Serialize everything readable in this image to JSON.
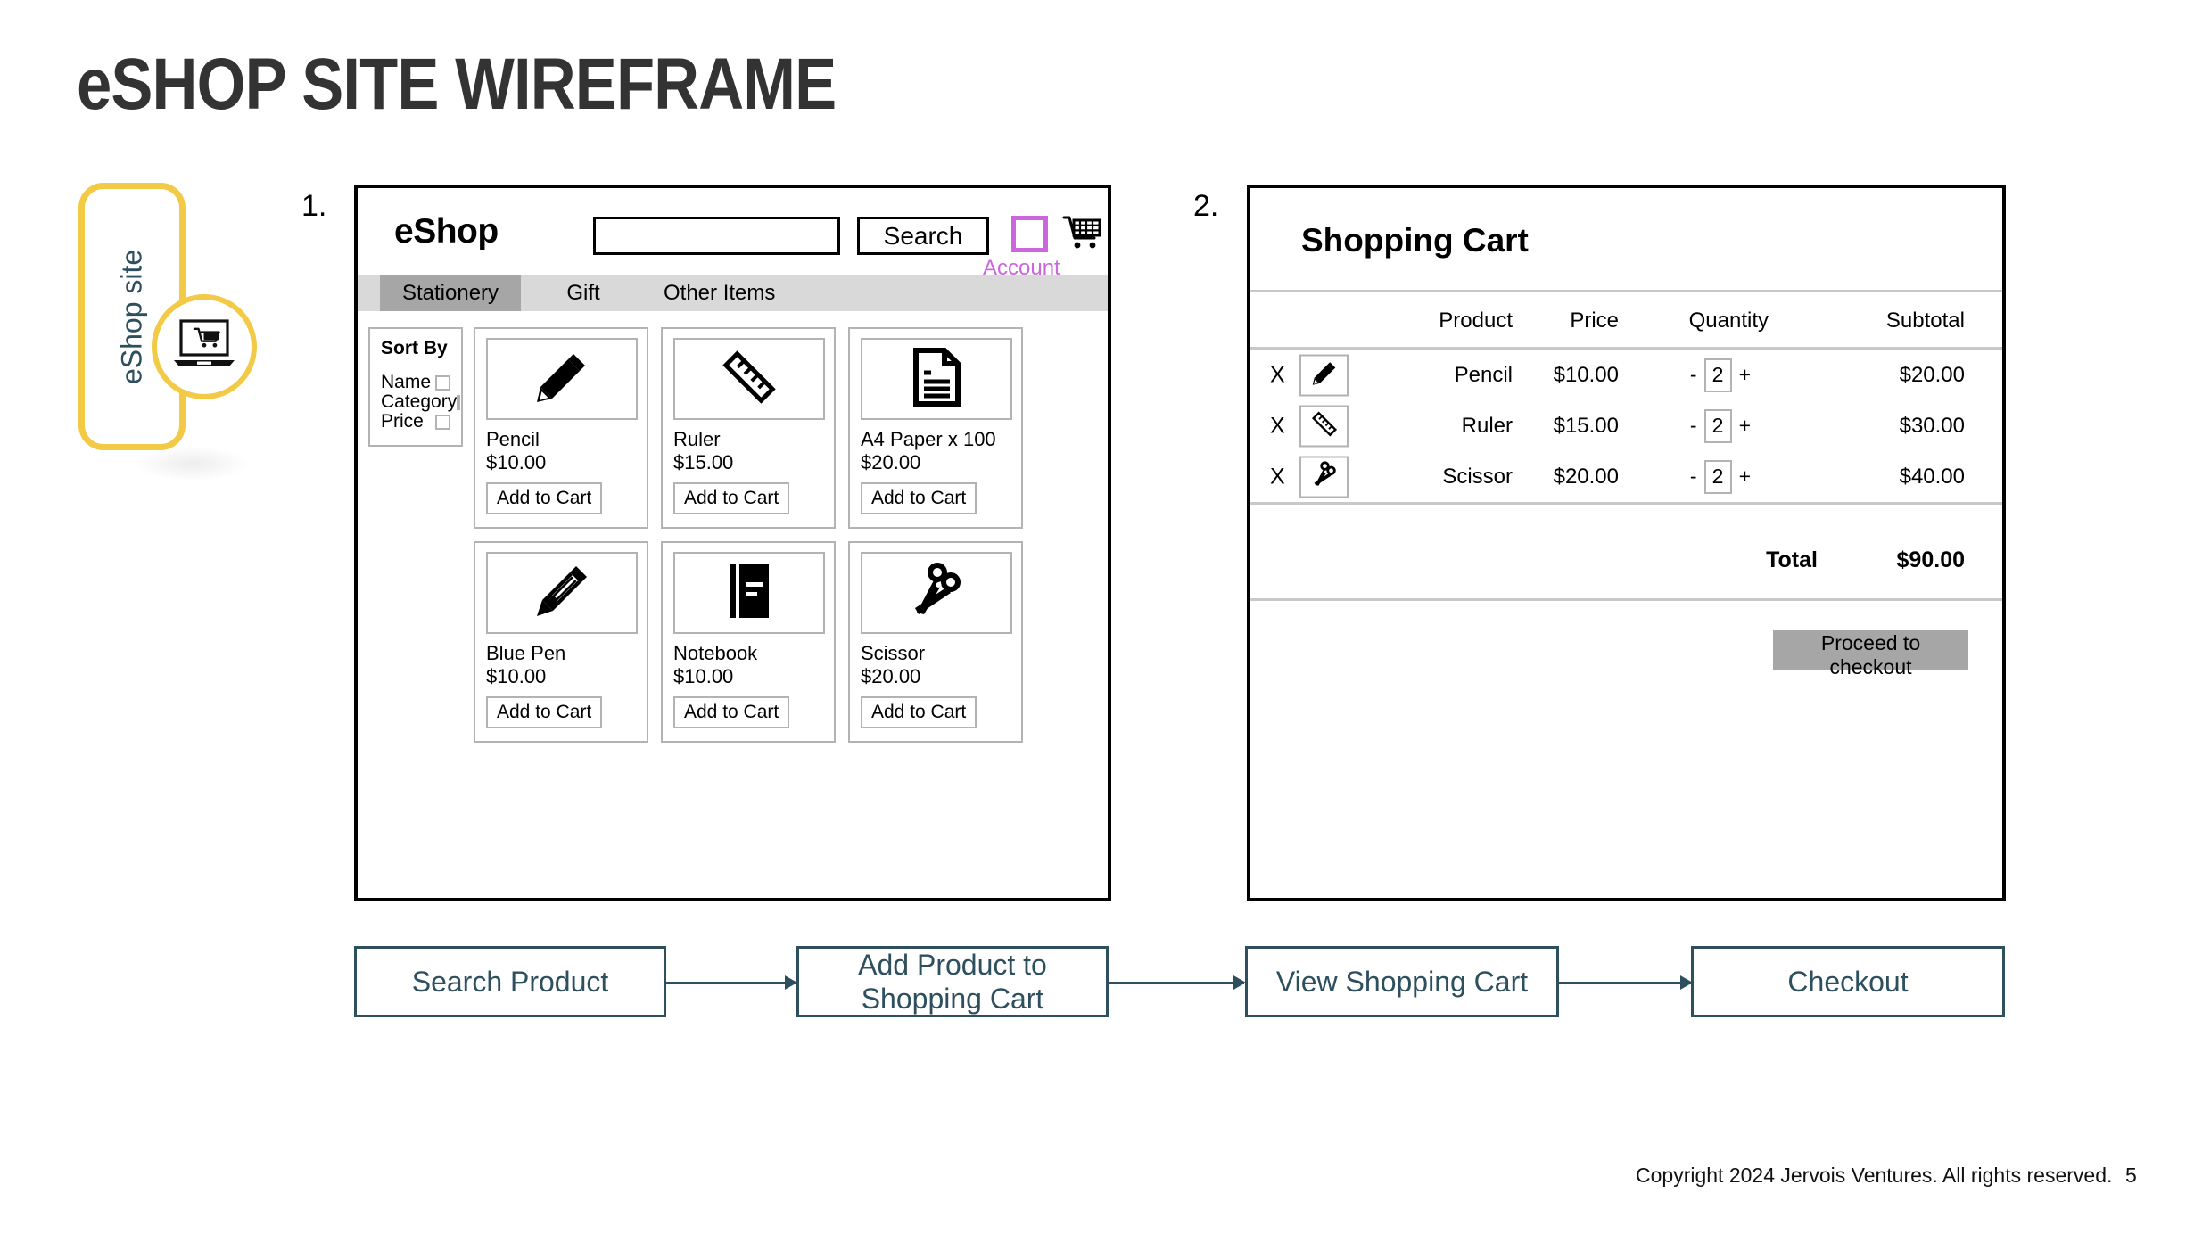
{
  "page_title": "eSHOP SITE WIREFRAME",
  "badge": {
    "label": "eShop site",
    "icon": "laptop-shopping-cart-icon",
    "border_color": "#f3ca45",
    "text_color": "#2e4f5e"
  },
  "steps": {
    "one": "1.",
    "two": "2."
  },
  "eshop": {
    "logo": "eShop",
    "search": {
      "value": "",
      "placeholder": "",
      "button_label": "Search"
    },
    "account_label": "Account",
    "account_color": "#cc66dd",
    "cart_icon": "shopping-cart-icon",
    "nav_tabs": [
      {
        "label": "Stationery",
        "active": true
      },
      {
        "label": "Gift",
        "active": false
      },
      {
        "label": "Other Items",
        "active": false
      }
    ],
    "sort_by": {
      "title": "Sort By",
      "options": [
        {
          "label": "Name",
          "checked": false
        },
        {
          "label": "Category",
          "checked": false
        },
        {
          "label": "Price",
          "checked": false
        }
      ]
    },
    "add_to_cart_label": "Add to Cart",
    "products": [
      {
        "name": "Pencil",
        "price": "$10.00",
        "icon": "pencil-icon"
      },
      {
        "name": "Ruler",
        "price": "$15.00",
        "icon": "ruler-icon"
      },
      {
        "name": "A4 Paper x 100",
        "price": "$20.00",
        "icon": "document-icon"
      },
      {
        "name": "Blue Pen",
        "price": "$10.00",
        "icon": "pen-icon"
      },
      {
        "name": "Notebook",
        "price": "$10.00",
        "icon": "notebook-icon"
      },
      {
        "name": "Scissor",
        "price": "$20.00",
        "icon": "scissors-icon"
      }
    ]
  },
  "cart": {
    "title": "Shopping Cart",
    "columns": [
      "Product",
      "Price",
      "Quantity",
      "Subtotal"
    ],
    "remove_label": "X",
    "minus_label": "-",
    "plus_label": "+",
    "rows": [
      {
        "product": "Pencil",
        "price": "$10.00",
        "quantity": "2",
        "subtotal": "$20.00",
        "icon": "pencil-icon"
      },
      {
        "product": "Ruler",
        "price": "$15.00",
        "quantity": "2",
        "subtotal": "$30.00",
        "icon": "ruler-icon"
      },
      {
        "product": "Scissor",
        "price": "$20.00",
        "quantity": "2",
        "subtotal": "$40.00",
        "icon": "scissors-icon"
      }
    ],
    "total_label": "Total",
    "total_value": "$90.00",
    "checkout_label": "Proceed to checkout",
    "checkout_bg": "#a6a6a6"
  },
  "flow": {
    "color": "#2e4f5e",
    "steps": [
      "Search Product",
      "Add Product to Shopping Cart",
      "View Shopping Cart",
      "Checkout"
    ]
  },
  "footer": {
    "copyright": "Copyright 2024 Jervois Ventures. All rights reserved.",
    "page_number": "5"
  }
}
